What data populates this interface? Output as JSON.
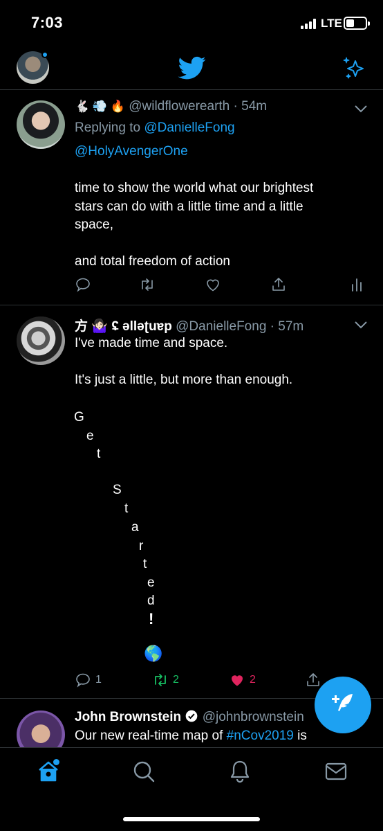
{
  "status": {
    "time": "7:03",
    "network": "LTE"
  },
  "tweets": [
    {
      "header_emoji": "🐇 💨 🔥",
      "handle": "@wildflowerearth",
      "sep": " · ",
      "time": "54m",
      "replying_label": "Replying to",
      "replying_to": [
        "@DanielleFong",
        "@HolyAvengerOne"
      ],
      "text": "time to show the world what our brightest\nstars can do with a little time and a little\nspace,\n\nand total freedom of action"
    },
    {
      "name": "方 🤷🏻‍♀️ ʢ ǝlləʈuɐp",
      "handle": "@DanielleFong",
      "sep": " · ",
      "time": "57m",
      "text": "I've made time and space.\n\nIt's just a little, but more than enough.",
      "letters": [
        "G",
        "e",
        "t",
        "S",
        "t",
        "a",
        "r",
        "t",
        "e",
        "d",
        "!",
        "🌎"
      ],
      "reply_count": "1",
      "retweet_count": "2",
      "like_count": "2"
    },
    {
      "name": "John Brownstein",
      "handle": "@johnbrownstein",
      "text_prefix": "Our new real-time map of ",
      "hashtag": "#nCov2019",
      "text_suffix": " is"
    }
  ],
  "colors": {
    "accent": "#1da1f2",
    "retweet": "#17bf63",
    "like": "#e0245e",
    "muted": "#8899a6",
    "divider": "#2f3336"
  },
  "icons": {
    "top": [
      "avatar",
      "twitter-bird-icon",
      "sparkle-icon"
    ],
    "actions": [
      "reply-icon",
      "retweet-icon",
      "like-icon",
      "share-icon",
      "analytics-icon"
    ],
    "tabs": [
      "home-icon",
      "search-icon",
      "notifications-icon",
      "messages-icon"
    ],
    "fab": "compose-icon"
  }
}
